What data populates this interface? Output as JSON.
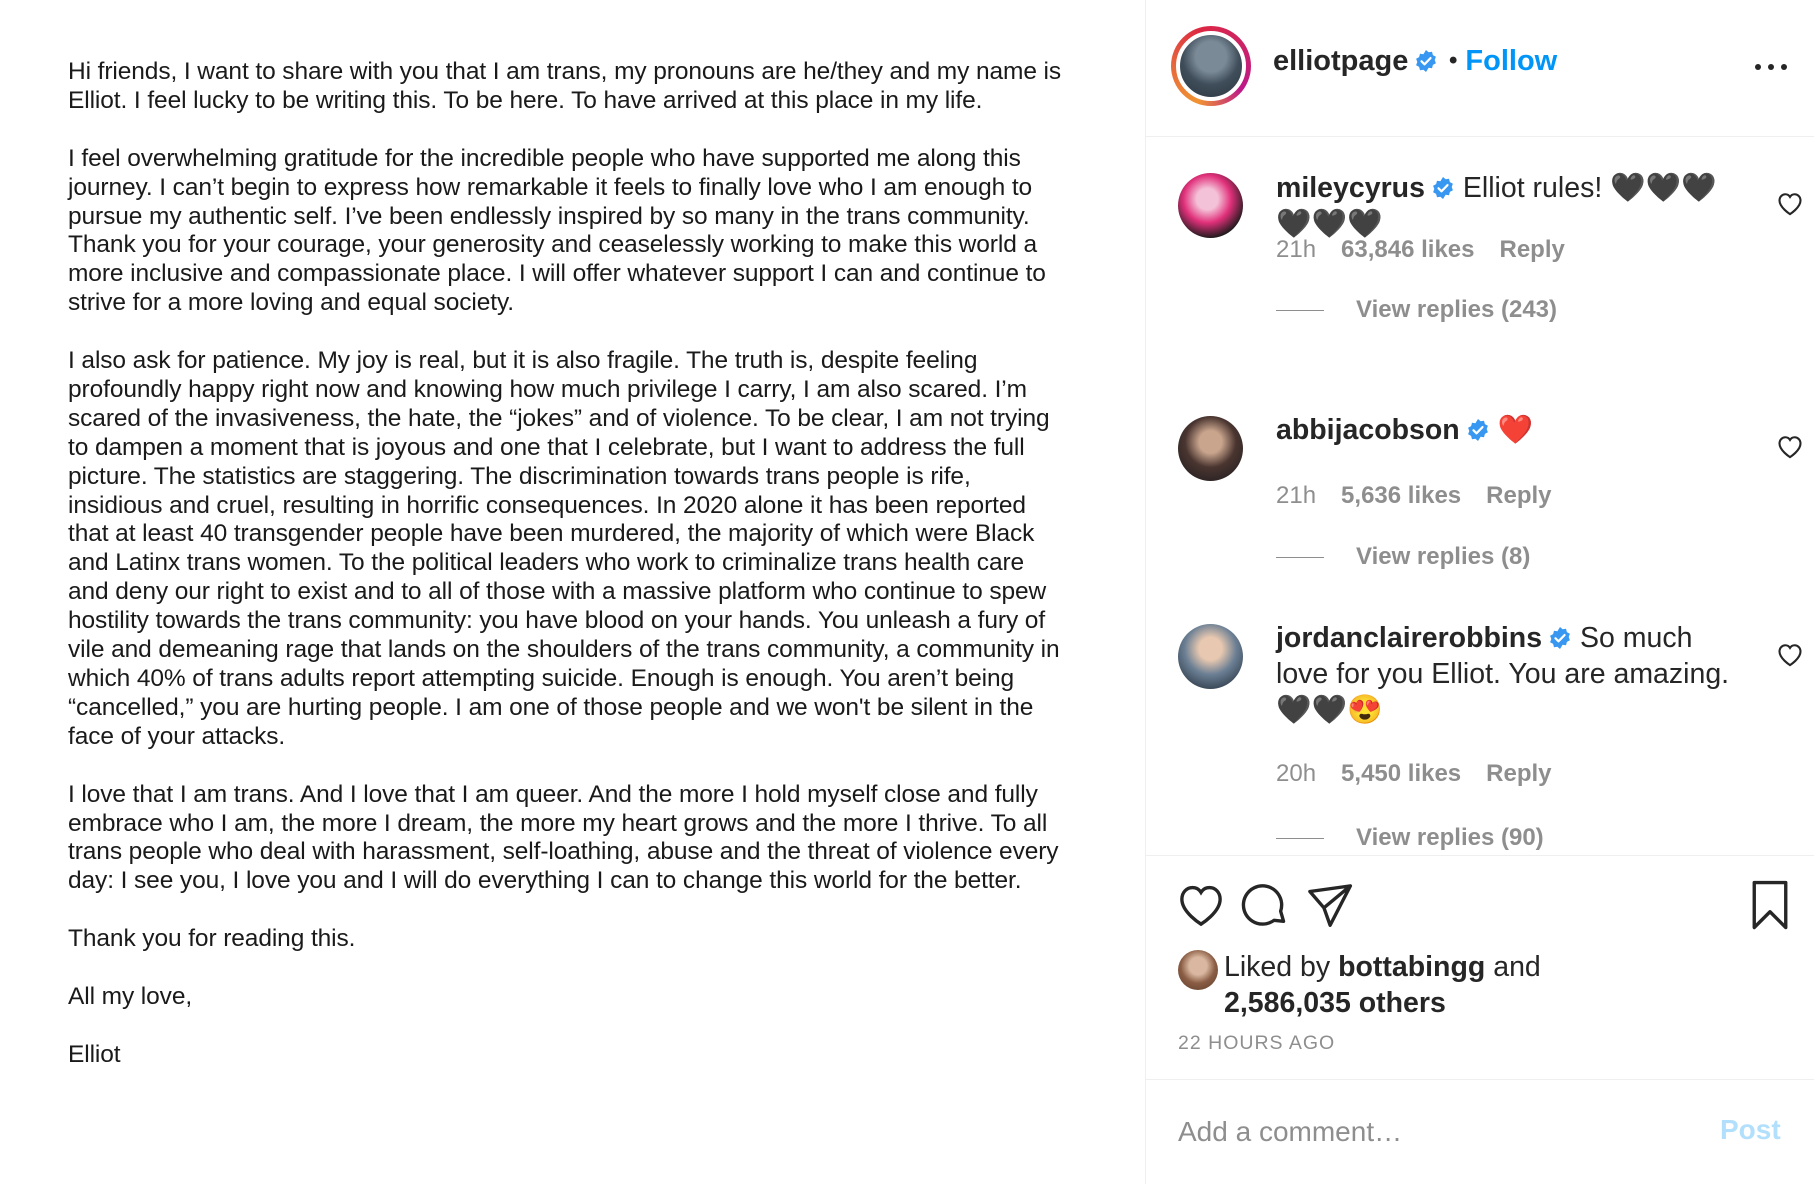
{
  "letter": {
    "paragraphs": [
      "Hi friends, I want to share with you that I am trans, my pronouns are he/they and my name is Elliot. I feel lucky to be writing this. To be here. To have arrived at this place in my life.",
      "I feel overwhelming gratitude for the incredible people who have supported me along this journey. I can’t begin to express how remarkable it feels to finally love who I am enough to pursue my authentic self. I’ve been endlessly inspired by so many in the trans community. Thank you for your courage, your generosity and ceaselessly working to make this world a more inclusive and compassionate place. I will offer whatever support I can and continue to strive for a more loving and equal society.",
      "I also ask for patience. My joy is real, but it is also fragile. The truth is, despite feeling profoundly happy right now and knowing how much privilege I carry, I am also scared. I’m scared of the invasiveness, the hate, the “jokes” and of violence. To be clear, I am not trying to dampen a moment that is joyous and one that I celebrate, but I want to address the full picture. The statistics are staggering. The discrimination towards trans people is rife, insidious and cruel, resulting in horrific consequences. In 2020 alone it has been reported that at least 40 transgender people have been murdered, the majority of which were Black and Latinx trans women. To the political leaders who work to criminalize trans health care and deny our right to exist and to all of those with a massive platform who continue to spew hostility towards the trans community: you have blood on your hands. You unleash a fury of vile and demeaning rage that lands on the shoulders of the trans community, a community in which 40% of trans adults report attempting suicide. Enough is enough. You aren’t being “cancelled,” you are hurting people. I am one of those people and we won't be silent in the face of your attacks.",
      "I love that I am trans. And I love that I am queer. And the more I hold myself close and fully embrace who I am, the more I dream, the more my heart grows and the more I thrive. To all trans people who deal with harassment, self-loathing, abuse and the threat of violence every day: I see you, I love you and I will do everything I can to change this world for the better.",
      "Thank you for reading this.",
      "All my love,",
      "Elliot"
    ]
  },
  "header": {
    "username": "elliotpage",
    "follow_label": "Follow",
    "bullet": "•"
  },
  "comments": [
    {
      "username": "mileycyrus",
      "text": "Elliot rules! 🖤🖤🖤🖤🖤🖤",
      "age": "21h",
      "likes": "63,846 likes",
      "reply": "Reply",
      "view_replies": "View replies (243)"
    },
    {
      "username": "abbijacobson",
      "text": "❤️",
      "age": "21h",
      "likes": "5,636 likes",
      "reply": "Reply",
      "view_replies": "View replies (8)"
    },
    {
      "username": "jordanclairerobbins",
      "text": "So much love for you Elliot. You are amazing. 🖤🖤😍",
      "age": "20h",
      "likes": "5,450 likes",
      "reply": "Reply",
      "view_replies": "View replies (90)"
    }
  ],
  "likes": {
    "prefix": "Liked by",
    "user": "bottabingg",
    "joiner": "and",
    "others": "2,586,035 others"
  },
  "timestamp": "22 HOURS AGO",
  "comment_box": {
    "placeholder": "Add a comment…",
    "post_label": "Post"
  },
  "colors": {
    "link_blue": "#0095f6",
    "post_disabled": "#b2dffc",
    "muted": "#8e8e8e",
    "text": "#262626"
  },
  "icons": [
    "verified-badge-icon",
    "more-options-icon",
    "heart-icon",
    "comment-icon",
    "share-icon",
    "bookmark-icon"
  ]
}
